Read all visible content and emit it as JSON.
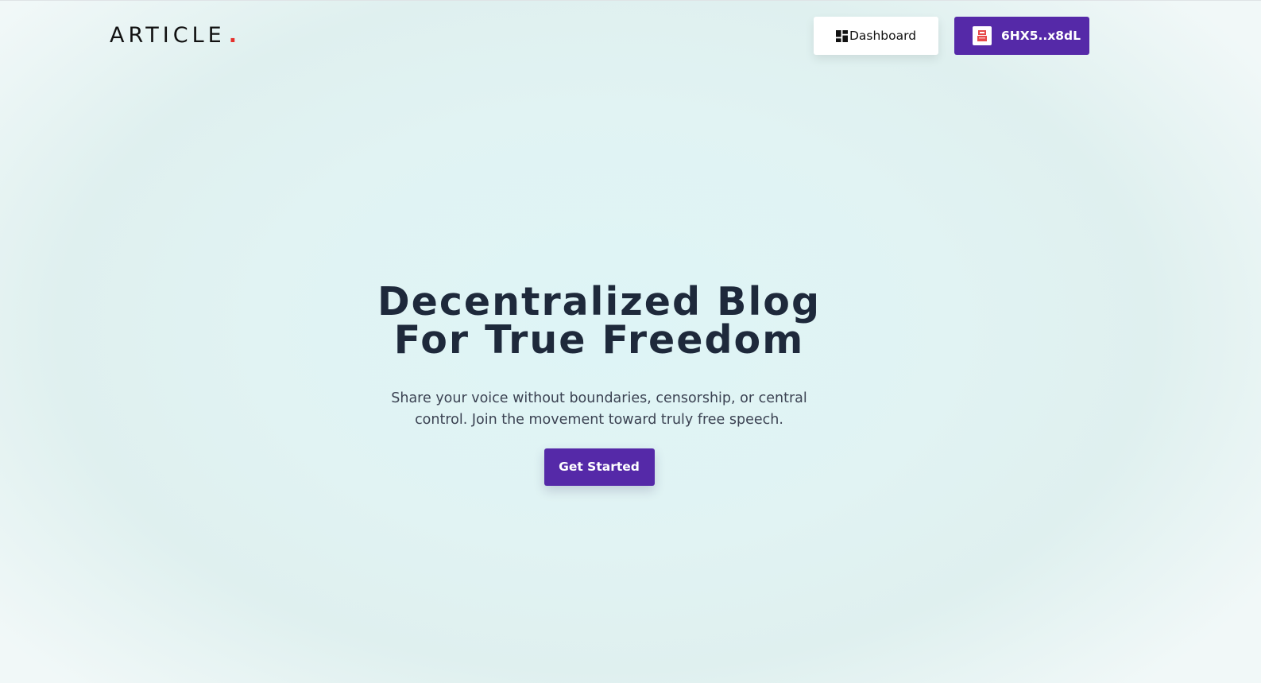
{
  "brand": {
    "name": "ARTICLE",
    "dot": ".",
    "dot_color": "#e5302b"
  },
  "header": {
    "dashboard_label": "Dashboard",
    "dashboard_icon": "dashboard-grid-icon",
    "wallet_label": "6HX5..x8dL",
    "wallet_icon": "wallet-avatar-icon"
  },
  "hero": {
    "title_line1": "Decentralized Blog",
    "title_line2": "For True Freedom",
    "subtitle": "Share your voice without boundaries, censorship, or central control. Join the movement toward truly free speech.",
    "cta_label": "Get Started"
  },
  "colors": {
    "accent": "#5529a8",
    "heading": "#1e293b",
    "background": "#e0f3f3"
  }
}
